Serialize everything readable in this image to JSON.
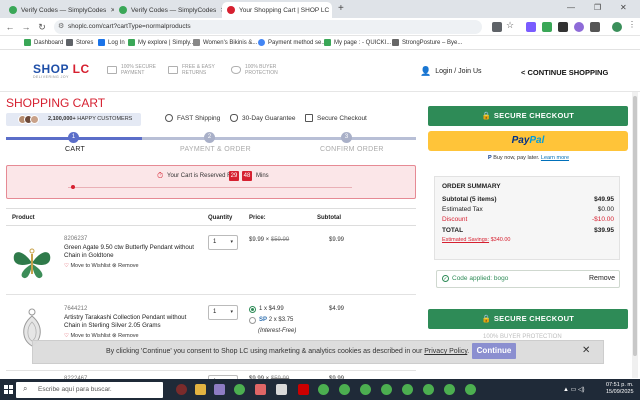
{
  "browser": {
    "tabs": [
      {
        "title": "Verify Codes — SimplyCodes"
      },
      {
        "title": "Verify Codes — SimplyCodes"
      },
      {
        "title": "Your Shopping Cart | SHOP LC"
      }
    ],
    "new_tab": "+",
    "url": "shoplc.com/cart?cartType=normalproducts",
    "bookmarks": [
      "Dashboard",
      "Stores",
      "Log In",
      "My explore | Simply...",
      "Women's Bikinis &...",
      "Payment method se...",
      "My page : - QUICKI...",
      "StrongPosture – Bye..."
    ]
  },
  "header": {
    "logo_shop": "SHOP",
    "logo_lc": "LC",
    "logo_sub": "DELIVERING JOY",
    "features": [
      {
        "line1": "100% SECURE",
        "line2": "PAYMENT"
      },
      {
        "line1": "FREE & EASY",
        "line2": "RETURNS"
      },
      {
        "line1": "100% BUYER",
        "line2": "PROTECTION"
      }
    ],
    "login": "Login / Join Us",
    "continue": "< CONTINUE SHOPPING"
  },
  "cart": {
    "title": "SHOPPING CART",
    "happy_count": "2,100,000+",
    "happy_label": "HAPPY CUSTOMERS",
    "perks": [
      "FAST Shipping",
      "30-Day Guarantee",
      "Secure Checkout"
    ],
    "steps": [
      {
        "num": "1",
        "label": "CART"
      },
      {
        "num": "2",
        "label": "PAYMENT & ORDER"
      },
      {
        "num": "3",
        "label": "CONFIRM ORDER"
      }
    ],
    "reserved_text": "Your Cart is Reserved For",
    "reserved_min": "29",
    "reserved_sec": "48",
    "reserved_unit": "Mins",
    "columns": {
      "product": "Product",
      "quantity": "Quantity",
      "price": "Price:",
      "subtotal": "Subtotal"
    },
    "items": [
      {
        "sku": "8206237",
        "name": "Green Agate 9.50 ctw Butterfly Pendant without Chain in Goldtone",
        "qty": "1",
        "price": "$9.99",
        "was": "$59.99",
        "subtotal": "$9.99",
        "wishlist": "Move to Wishlist",
        "remove": "Remove"
      },
      {
        "sku": "7644212",
        "name": "Artistry Tarakashi Collection Pendant without Chain in Sterling Silver 2.05 Grams",
        "qty": "1",
        "opt1": "1 x $4.99",
        "opt2_prefix": "SP",
        "opt2": "2 x $3.75",
        "opt2_note": "(Interest-Free)",
        "subtotal": "$4.99",
        "wishlist": "Move to Wishlist",
        "remove": "Remove"
      },
      {
        "sku": "8222467",
        "qty": "1",
        "price": "$9.99",
        "was": "$59.99",
        "subtotal": "$9.99"
      }
    ]
  },
  "sidebar": {
    "secure_checkout": "SECURE CHECKOUT",
    "paypal_pay": "Pay",
    "paypal_pal": "Pal",
    "pay_later": "Buy now, pay later.",
    "learn_more": "Learn more",
    "summary_title": "ORDER SUMMARY",
    "subtotal_label": "Subtotal (5 items)",
    "subtotal_value": "$49.95",
    "tax_label": "Estimated Tax",
    "tax_value": "$0.00",
    "discount_label": "Discount",
    "discount_value": "-$10.00",
    "total_label": "TOTAL",
    "total_value": "$39.95",
    "savings_label": "Estimated Savings:",
    "savings_value": "$340.00",
    "coupon_text": "Code applied: bogo",
    "coupon_remove": "Remove",
    "secure_checkout_2": "SECURE CHECKOUT",
    "buyer_protection": "100% BUYER PROTECTION"
  },
  "cookie": {
    "text_before": "By clicking 'Continue' you consent to Shop LC using marketing & analytics cookies as described in our",
    "privacy": "Privacy Policy",
    "period": ".",
    "button": "Continue"
  },
  "taskbar": {
    "search": "Escribe aquí para buscar.",
    "time": "07:51 p. m.",
    "date": "15/09/2025"
  }
}
